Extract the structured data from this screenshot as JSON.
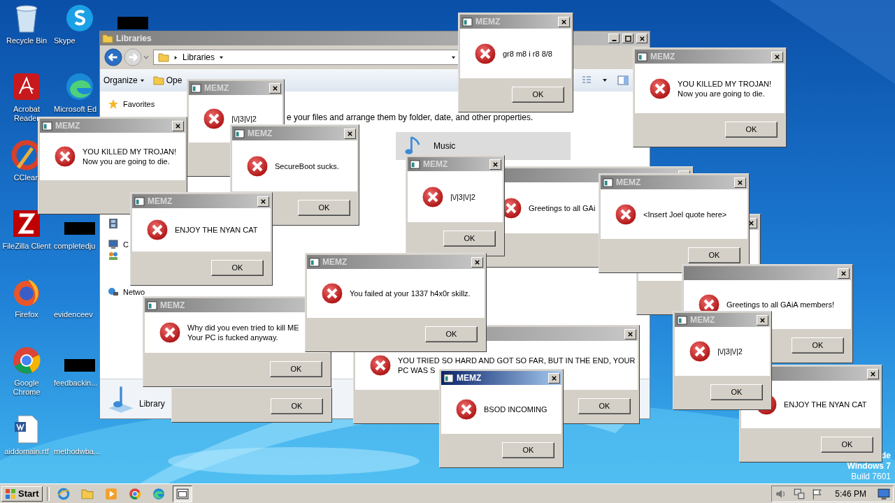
{
  "desktop_icons": [
    {
      "kind": "recycle",
      "label": "Recycle Bin"
    },
    {
      "kind": "skype",
      "label": "Skype"
    },
    {
      "kind": "redacted"
    },
    {
      "kind": "acrobat",
      "label": "Acrobat\nReader"
    },
    {
      "kind": "edge",
      "label": "Microsoft Ed"
    },
    {
      "kind": "ccleaner",
      "label": "CClean"
    },
    {
      "kind": "filezilla",
      "label": "FileZilla Client"
    },
    {
      "kind": "redacted",
      "label": "completedju"
    },
    {
      "kind": "firefox",
      "label": "Firefox"
    },
    {
      "kind": "blank",
      "label": "evidenceev"
    },
    {
      "kind": "chrome",
      "label": "Google\nChrome"
    },
    {
      "kind": "redacted",
      "label": "feedbackin..."
    },
    {
      "kind": "word",
      "label": "aiddomain.rtf"
    },
    {
      "kind": "blank",
      "label": "methodwba..."
    }
  ],
  "explorer": {
    "title": "Libraries",
    "address": "Libraries",
    "toolbar": [
      "Organize",
      "Ope"
    ],
    "nav": [
      {
        "kind": "favorites",
        "label": "Favorites"
      },
      {
        "kind": "video"
      },
      {
        "kind": "computer",
        "label": "C"
      },
      {
        "kind": "homegroup"
      },
      {
        "kind": "network",
        "label": "Netwo"
      }
    ],
    "description": "e your files and arrange them by folder, date, and other properties.",
    "library_tile": "Music",
    "details": "Library"
  },
  "dialogs": [
    {
      "title": "MEMZ",
      "active": false,
      "message": "YOU KILLED MY TROJAN!\nNow you are going to die."
    },
    {
      "title": "MEMZ",
      "active": false,
      "message": "|\\/|3|\\/|2"
    },
    {
      "title": "MEMZ",
      "active": false,
      "message": "SecureBoot sucks.",
      "button": "OK"
    },
    {
      "title": "MEMZ",
      "active": false,
      "message": "ENJOY THE NYAN CAT",
      "button": "OK"
    },
    {
      "title": "MEMZ",
      "active": false,
      "message": "gr8 m8 i r8 8/8",
      "button": "OK"
    },
    {
      "title": "MEMZ",
      "active": false,
      "message": "|\\/|3|\\/|2",
      "button": "OK"
    },
    {
      "title": "MEMZ",
      "active": false,
      "message": "YOU KILLED MY TROJAN!\nNow you are going to die.",
      "button": "OK"
    },
    {
      "active": false,
      "message": "Greetings to all GAi"
    },
    {
      "title": "MEMZ",
      "active": false,
      "message": "You failed at your 1337 h4x0r skillz.",
      "button": "OK"
    },
    {
      "title": "MEMZ",
      "active": false,
      "message": "<Insert Joel quote here>",
      "button": "OK"
    },
    {
      "title": "MEMZ",
      "active": false,
      "message": "Why did you even tried to kill ME\nYour PC is fucked anyway.",
      "button": "OK"
    },
    {
      "active": false
    },
    {
      "button": "OK"
    },
    {
      "active": false,
      "message": "YOU TRIED SO HARD AND GOT SO FAR, BUT IN THE END, YOUR\nPC WAS S",
      "button": "OK"
    },
    {
      "active": false,
      "message": "Greetings to all GAiA members!",
      "button": "OK"
    },
    {
      "title": "MEMZ",
      "active": true,
      "message": "BSOD INCOMING",
      "button": "OK"
    },
    {
      "title": "MEMZ",
      "active": false,
      "message": "|\\/|3|\\/|2",
      "button": "OK"
    },
    {
      "active": false,
      "message": "ENJOY THE NYAN CAT",
      "button": "OK"
    }
  ],
  "os_label": [
    "de",
    "Windows 7",
    "Build 7601"
  ],
  "taskbar": {
    "start": "Start",
    "items": [
      {
        "kind": "ie",
        "selected": false
      },
      {
        "kind": "explorer",
        "selected": false
      },
      {
        "kind": "media",
        "selected": false
      },
      {
        "kind": "chrome",
        "selected": false
      },
      {
        "kind": "edge",
        "selected": false
      },
      {
        "kind": "app",
        "selected": true
      }
    ],
    "clock": "5:46 PM"
  }
}
